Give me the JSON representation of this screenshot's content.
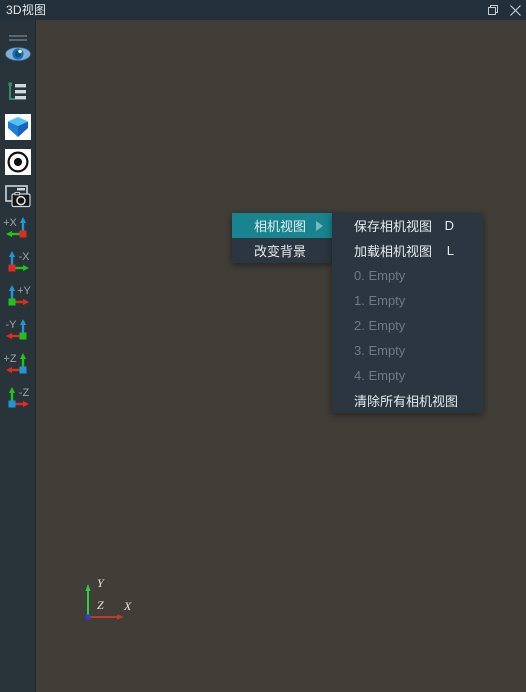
{
  "window": {
    "title": "3D视图",
    "buttons": [
      {
        "name": "restore-window-button",
        "icon": "restore-icon"
      },
      {
        "name": "close-window-button",
        "icon": "close-icon"
      }
    ]
  },
  "sidebar": {
    "tools": [
      {
        "name": "menu-toggle",
        "icon": "hamburger-icon",
        "label": ""
      },
      {
        "name": "visibility-toggle",
        "icon": "eye-icon",
        "label": ""
      },
      {
        "name": "scene-tree",
        "icon": "tree-list-icon",
        "label": ""
      },
      {
        "name": "model-view",
        "icon": "blue-cube-icon",
        "label": ""
      },
      {
        "name": "pivot-target",
        "icon": "target-circle-icon",
        "label": ""
      },
      {
        "name": "screenshot",
        "icon": "camera-icon",
        "label": ""
      }
    ],
    "axis_views": [
      {
        "name": "view-plus-x",
        "label": "+X",
        "color": "#e02b20",
        "icon": "axis-plus-x-icon"
      },
      {
        "name": "view-minus-x",
        "label": "-X",
        "color": "#e02b20",
        "icon": "axis-minus-x-icon"
      },
      {
        "name": "view-plus-y",
        "label": "+Y",
        "color": "#22c11e",
        "icon": "axis-plus-y-icon"
      },
      {
        "name": "view-minus-y",
        "label": "-Y",
        "color": "#22c11e",
        "icon": "axis-minus-y-icon"
      },
      {
        "name": "view-plus-z",
        "label": "+Z",
        "color": "#2196d8",
        "icon": "axis-plus-z-icon"
      },
      {
        "name": "view-minus-z",
        "label": "-Z",
        "color": "#2196d8",
        "icon": "axis-minus-z-icon"
      }
    ]
  },
  "viewport": {
    "background_color": "#413e38",
    "axis_gizmo": {
      "x_label": "X",
      "y_label": "Y",
      "z_label": "Z",
      "x_color": "#c0392b",
      "y_color": "#2ecc40",
      "z_color": "#2b3fd8"
    }
  },
  "context_menu": {
    "highlight_color": "#17848f",
    "background_color": "#2b3640",
    "items": [
      {
        "label": "相机视图",
        "shortcut": "",
        "has_submenu": true,
        "highlighted": true,
        "disabled": false
      },
      {
        "label": "改变背景",
        "shortcut": "",
        "has_submenu": false,
        "highlighted": false,
        "disabled": false
      }
    ]
  },
  "submenu": {
    "items": [
      {
        "label": "保存相机视图",
        "shortcut": "D",
        "disabled": false
      },
      {
        "label": "加载相机视图",
        "shortcut": "L",
        "disabled": false
      },
      {
        "label": "0. Empty",
        "shortcut": "",
        "disabled": true
      },
      {
        "label": "1. Empty",
        "shortcut": "",
        "disabled": true
      },
      {
        "label": "2. Empty",
        "shortcut": "",
        "disabled": true
      },
      {
        "label": "3. Empty",
        "shortcut": "",
        "disabled": true
      },
      {
        "label": "4. Empty",
        "shortcut": "",
        "disabled": true
      },
      {
        "label": "清除所有相机视图",
        "shortcut": "",
        "disabled": false
      }
    ]
  }
}
